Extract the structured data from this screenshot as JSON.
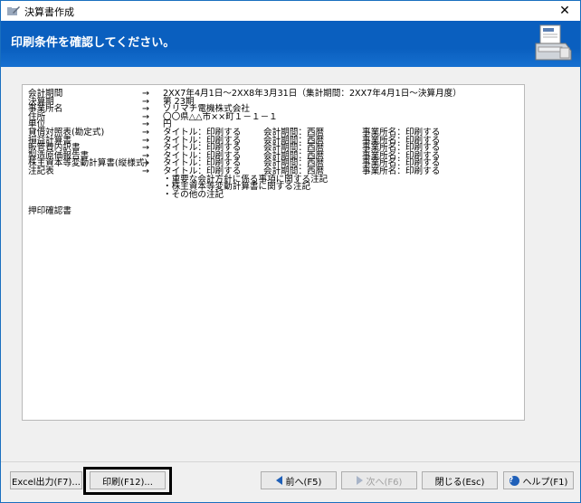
{
  "window": {
    "title": "決算書作成",
    "close_glyph": "✕"
  },
  "header": {
    "heading": "印刷条件を確認してください。"
  },
  "settings": {
    "rows": [
      {
        "label": "会計期間",
        "arrow": "→",
        "value": "2XX7年4月1日〜2XX8年3月31日（集計期間：2XX7年4月1日〜決算月度）",
        "period": "",
        "office": ""
      },
      {
        "label": "決算期",
        "arrow": "→",
        "value": "第 23期",
        "period": "",
        "office": ""
      },
      {
        "label": "事業所名",
        "arrow": "→",
        "value": "ソリマチ電機株式会社",
        "period": "",
        "office": ""
      },
      {
        "label": "住所",
        "arrow": "→",
        "value": "〇〇県△△市××町１－１－１",
        "period": "",
        "office": ""
      },
      {
        "label": "単位",
        "arrow": "→",
        "value": "円",
        "period": "",
        "office": ""
      },
      {
        "label": "貸借対照表(勘定式)",
        "arrow": "→",
        "value": "タイトル：印刷する",
        "period": "会計期間：西暦",
        "office": "事業所名：印刷する"
      },
      {
        "label": "損益計算書",
        "arrow": "→",
        "value": "タイトル：印刷する",
        "period": "会計期間：西暦",
        "office": "事業所名：印刷する"
      },
      {
        "label": "販管費内訳書",
        "arrow": "→",
        "value": "タイトル：印刷する",
        "period": "会計期間：西暦",
        "office": "事業所名：印刷する"
      },
      {
        "label": "製造原価報告書",
        "arrow": "→",
        "value": "タイトル：印刷する",
        "period": "会計期間：西暦",
        "office": "事業所名：印刷する"
      },
      {
        "label": "株主資本等変動計算書(縦様式)",
        "arrow": "→",
        "value": "タイトル：印刷する",
        "period": "会計期間：西暦",
        "office": "事業所名：印刷する"
      },
      {
        "label": "注記表",
        "arrow": "→",
        "value": "タイトル：印刷する",
        "period": "会計期間：西暦",
        "office": "事業所名：印刷する"
      },
      {
        "label": "",
        "arrow": "",
        "value": "・重要な会計方針に係る事項に関する注記",
        "period": "",
        "office": ""
      },
      {
        "label": "",
        "arrow": "",
        "value": "・株主資本等変動計算書に関する注記",
        "period": "",
        "office": ""
      },
      {
        "label": "",
        "arrow": "",
        "value": "・その他の注記",
        "period": "",
        "office": ""
      }
    ],
    "approval_label": "押印確認書"
  },
  "buttons": {
    "excel": "Excel出力(F7)...",
    "print": "印刷(F12)...",
    "prev": "前へ(F5)",
    "next": "次へ(F6)",
    "close": "閉じる(Esc)",
    "help": "ヘルプ(F1)"
  },
  "icons": {
    "app": "folder-pen-icon",
    "printer": "printer-icon",
    "prev": "triangle-left-icon",
    "next": "triangle-right-icon",
    "help": "question-circle-icon"
  }
}
